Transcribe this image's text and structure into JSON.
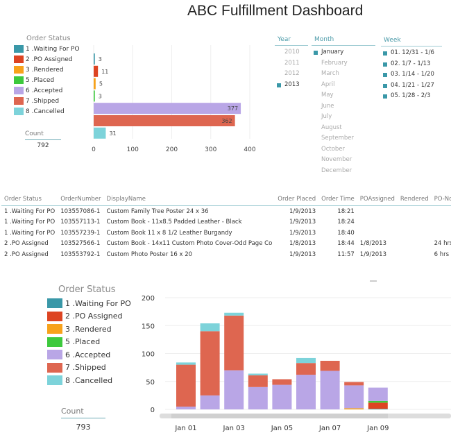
{
  "title": "ABC Fulfillment Dashboard",
  "colors": {
    "1 .Waiting For PO": "#3a98a8",
    "2 .PO Assigned": "#dd4422",
    "3 .Rendered": "#f7a21b",
    "5 .Placed": "#3dc93d",
    "6 .Accepted": "#b9a6e6",
    "7 .Shipped": "#de6650",
    "8 .Cancelled": "#7dd3da"
  },
  "legend": {
    "title": "Order Status",
    "items": [
      "1 .Waiting For PO",
      "2 .PO Assigned",
      "3 .Rendered",
      "5 .Placed",
      "6 .Accepted",
      "7 .Shipped",
      "8 .Cancelled"
    ]
  },
  "top_count": {
    "label": "Count",
    "value": "792"
  },
  "bottom_count": {
    "label": "Count",
    "value": "793"
  },
  "slicers": {
    "year": {
      "label": "Year",
      "items": [
        {
          "label": "2010",
          "selected": false
        },
        {
          "label": "2011",
          "selected": false
        },
        {
          "label": "2012",
          "selected": false
        },
        {
          "label": "2013",
          "selected": true
        }
      ]
    },
    "month": {
      "label": "Month",
      "items": [
        {
          "label": "January",
          "selected": true
        },
        {
          "label": "February",
          "selected": false
        },
        {
          "label": "March",
          "selected": false
        },
        {
          "label": "April",
          "selected": false
        },
        {
          "label": "May",
          "selected": false
        },
        {
          "label": "June",
          "selected": false
        },
        {
          "label": "July",
          "selected": false
        },
        {
          "label": "August",
          "selected": false
        },
        {
          "label": "September",
          "selected": false
        },
        {
          "label": "October",
          "selected": false
        },
        {
          "label": "November",
          "selected": false
        },
        {
          "label": "December",
          "selected": false
        }
      ]
    },
    "week": {
      "label": "Week",
      "items": [
        {
          "label": "01. 12/31 - 1/6",
          "selected": true
        },
        {
          "label": "02. 1/7 - 1/13",
          "selected": true
        },
        {
          "label": "03. 1/14 - 1/20",
          "selected": true
        },
        {
          "label": "04. 1/21 - 1/27",
          "selected": true
        },
        {
          "label": "05. 1/28 - 2/3",
          "selected": true
        }
      ]
    }
  },
  "table": {
    "columns": [
      "Order Status",
      "OrderNumber",
      "DisplayName",
      "Order Placed",
      "Order Time",
      "POAssigned",
      "Rendered",
      "PO-Now"
    ],
    "rows": [
      [
        "1 .Waiting For PO",
        "103557086-1",
        "Custom Family Tree Poster 24 x 36",
        "1/9/2013",
        "18:21",
        "",
        "",
        ""
      ],
      [
        "1 .Waiting For PO",
        "103557113-1",
        "Custom Book - 11x8.5 Padded Leather - Black",
        "1/9/2013",
        "18:24",
        "",
        "",
        ""
      ],
      [
        "1 .Waiting For PO",
        "103557239-1",
        "Custom Book 11 x 8 1/2  Leather Burgandy",
        "1/9/2013",
        "18:40",
        "",
        "",
        ""
      ],
      [
        "2 .PO Assigned",
        "103527566-1",
        "Custom Book - 14x11 Custom Photo Cover-Odd Page Co",
        "1/8/2013",
        "18:44",
        "1/8/2013",
        "",
        "24 hrs"
      ],
      [
        "2 .PO Assigned",
        "103553792-1",
        "Custom Photo Poster 16 x 20",
        "1/9/2013",
        "11:57",
        "1/9/2013",
        "",
        "6 hrs"
      ]
    ]
  },
  "chart_data": [
    {
      "type": "bar",
      "orientation": "horizontal",
      "categories": [
        "1 .Waiting For PO",
        "2 .PO Assigned",
        "3 .Rendered",
        "5 .Placed",
        "6 .Accepted",
        "7 .Shipped",
        "8 .Cancelled"
      ],
      "values": [
        3,
        11,
        5,
        3,
        377,
        362,
        31
      ],
      "xlim": [
        0,
        400
      ],
      "xticks": [
        0,
        100,
        200,
        300,
        400
      ],
      "grid": true
    },
    {
      "type": "bar",
      "stacked": true,
      "categories": [
        "Jan 01",
        "Jan 02",
        "Jan 03",
        "Jan 04",
        "Jan 05",
        "Jan 06",
        "Jan 07",
        "Jan 08",
        "Jan 09"
      ],
      "xtick_labels": [
        "Jan 01",
        "",
        "Jan 03",
        "",
        "Jan 05",
        "",
        "Jan 07",
        "",
        "Jan 09"
      ],
      "ylim": [
        0,
        200
      ],
      "yticks": [
        0,
        50,
        100,
        150,
        200
      ],
      "grid": true,
      "series": [
        {
          "name": "1 .Waiting For PO",
          "values": [
            0,
            0,
            0,
            0,
            0,
            0,
            0,
            0,
            1
          ]
        },
        {
          "name": "2 .PO Assigned",
          "values": [
            0,
            0,
            0,
            0,
            0,
            0,
            0,
            0,
            11
          ]
        },
        {
          "name": "3 .Rendered",
          "values": [
            0,
            0,
            0,
            0,
            0,
            0,
            0,
            2,
            0
          ]
        },
        {
          "name": "5 .Placed",
          "values": [
            0,
            0,
            0,
            0,
            0,
            0,
            0,
            0,
            3
          ]
        },
        {
          "name": "6 .Accepted",
          "values": [
            5,
            25,
            70,
            40,
            44,
            62,
            69,
            41,
            24
          ]
        },
        {
          "name": "7 .Shipped",
          "values": [
            75,
            115,
            98,
            21,
            10,
            21,
            18,
            6,
            0
          ]
        },
        {
          "name": "8 .Cancelled",
          "values": [
            4,
            14,
            5,
            3,
            0,
            9,
            0,
            0,
            0
          ]
        }
      ]
    }
  ]
}
